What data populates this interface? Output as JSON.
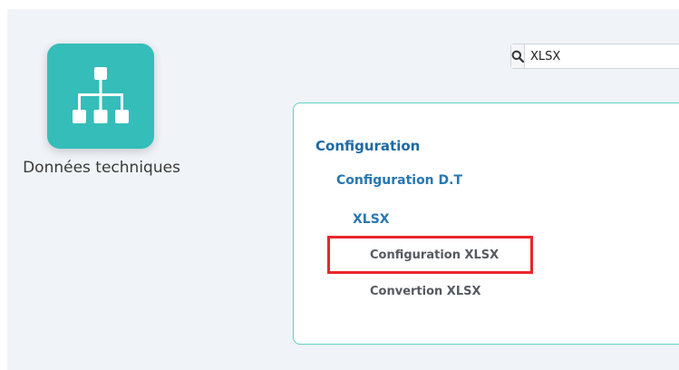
{
  "app": {
    "label": "Données techniques",
    "icon": "sitemap-icon",
    "tile_color": "#35bdb9"
  },
  "search": {
    "value": "XLSX",
    "icon": "search-icon"
  },
  "results": {
    "border_color": "#5fd1c5",
    "items": [
      {
        "label": "Configuration"
      },
      {
        "label": "Configuration D.T"
      },
      {
        "label": "XLSX"
      },
      {
        "label": "Configuration XLSX"
      },
      {
        "label": "Convertion XLSX"
      }
    ]
  },
  "highlight_color": "#e8272b"
}
